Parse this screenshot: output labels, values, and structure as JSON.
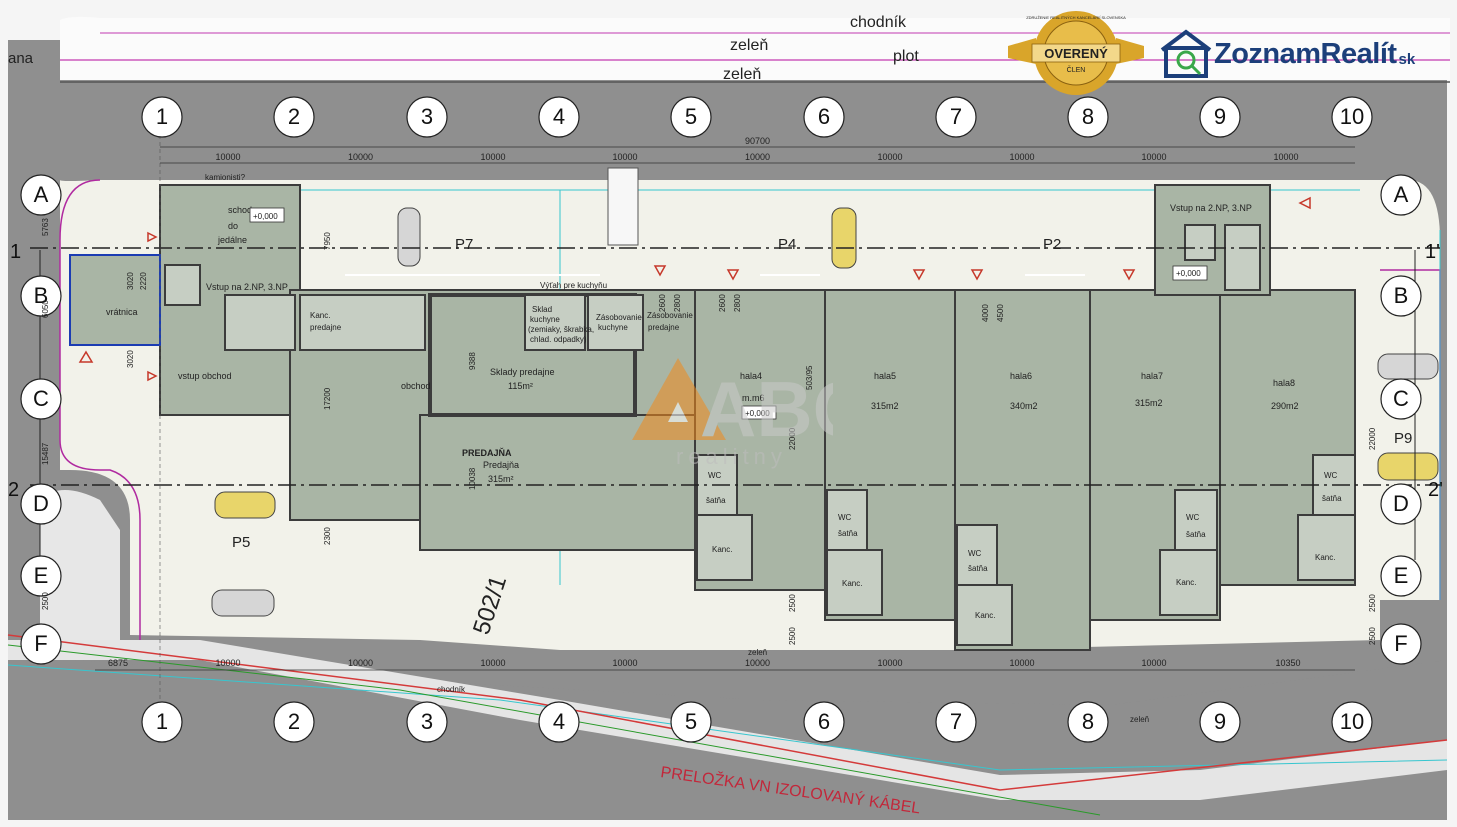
{
  "top": {
    "chodnik_top": "chodník",
    "zelen1": "zeleň",
    "zelen2": "zeleň",
    "plot": "plot",
    "ana": "ana"
  },
  "grid": {
    "columns": [
      "1",
      "2",
      "3",
      "4",
      "5",
      "6",
      "7",
      "8",
      "9",
      "10"
    ],
    "rows_left": [
      "A",
      "B",
      "C",
      "D",
      "E",
      "F"
    ],
    "rows_right": [
      "A",
      "B",
      "C",
      "D",
      "E",
      "F"
    ],
    "axis_1": "1",
    "axis_1p": "1'",
    "axis_2": "2",
    "axis_2p": "2'"
  },
  "dims": {
    "total": "90700",
    "top_spans": [
      "10000",
      "10000",
      "10000",
      "10000",
      "10000",
      "10000",
      "10000",
      "10000",
      "10000"
    ],
    "bottom_spans": [
      "6875",
      "10000",
      "10000",
      "10000",
      "10000",
      "10000",
      "10000",
      "10000",
      "10000",
      "10350"
    ],
    "v_left": [
      "5763",
      "6050",
      "15487",
      "2500"
    ],
    "v_mid": [
      "7950",
      "17200",
      "2300"
    ],
    "sklady_h": "9388",
    "predajna_h": "10038",
    "hala_vals": [
      "2600",
      "2800",
      "2600",
      "2800",
      "4000",
      "4500",
      "22000",
      "22000",
      "2500",
      "2500",
      "2500",
      "2500"
    ],
    "wc_dims": [
      "3020",
      "2220",
      "3020"
    ]
  },
  "rooms": {
    "kamionisti": "kamionisti?",
    "schody": "schody",
    "do": "do",
    "jedalne": "jedálne",
    "level_000": "+0,000",
    "vstup_2np_left": "Vstup na 2.NP, 3.NP",
    "vratnica": "vrátnica",
    "kanc_left": "Kanc.",
    "predajne_small": "predajne",
    "vstup_obchod": "vstup obchod",
    "obchod": "obchod",
    "vyrah": "Výťah pre kuchyňu",
    "sklad_kuchyne": "Sklad",
    "sklad_kuchyne2": "kuchyne",
    "sklad_kuchyne3": "(zemiaky, škrabka,",
    "sklad_kuchyne4": "chlad. odpadky)",
    "zasobovanie_kuchyne": "Zásobovanie",
    "zasobovanie_kuchyne2": "kuchyne",
    "zasobovanie_predajne": "Zásobovanie",
    "zasobovanie_predajne2": "predajne",
    "sklady_predajne": "Sklady predajne",
    "sklady_area": "115m²",
    "predajna_caps": "PREDAJŇA",
    "predajna": "Predajňa",
    "predajna_area": "315m²",
    "hala4": "hala4",
    "hala4_area": "m.m6",
    "hala5": "hala5",
    "hala5_area": "315m2",
    "hala6": "hala6",
    "hala6_area": "340m2",
    "hala7": "hala7",
    "hala7_area": "315m2",
    "hala8": "hala8",
    "hala8_area": "290m2",
    "vstup_2np_right": "Vstup na 2.NP, 3.NP",
    "wc": "WC",
    "satna": "šatňa",
    "kanc": "Kanc.",
    "parcel": "502/1",
    "dim_503": "503/95"
  },
  "parking": {
    "p7": "P7",
    "p4": "P4",
    "p2": "P2",
    "p5": "P5",
    "p9": "P9"
  },
  "bottom": {
    "zelen_mid": "zeleň",
    "chodnik": "chodník",
    "zelen_right": "zeleň",
    "cable": "PRELOŽKA VN IZOLOVANÝ KÁBEL"
  },
  "badge": {
    "main": "OVERENÝ",
    "sub": "ČLEN",
    "ring": "ZDRUŽENIE REALITNÝCH KANCELÁRIÍ SLOVENSKA"
  },
  "logo": {
    "text": "ZoznamRealít",
    "suffix": "sk"
  },
  "watermark": {
    "letters": "ABC",
    "sub": "realitny"
  },
  "colors": {
    "asphalt": "#8b8b8b",
    "building": "#a9b5a5",
    "wall": "#3c3c3c",
    "paving": "#f1f1ea",
    "magenta": "#b02aa0",
    "cyan": "#37c6cf",
    "logo_blue": "#1c3f7a",
    "badge_gold": "#d9a52a",
    "watermark_orange": "#f08a1c"
  }
}
